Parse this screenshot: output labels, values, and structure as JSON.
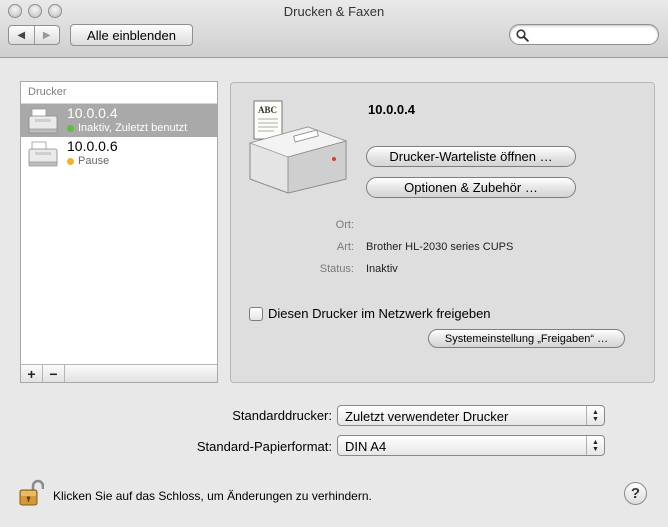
{
  "window": {
    "title": "Drucken & Faxen"
  },
  "toolbar": {
    "back_icon": "back-arrow-icon",
    "forward_icon": "forward-arrow-icon",
    "show_all_label": "Alle einblenden",
    "search_placeholder": "",
    "search_value": ""
  },
  "printer_list": {
    "header": "Drucker",
    "items": [
      {
        "name": "10.0.0.4",
        "status": "Inaktiv, Zuletzt benutzt",
        "status_color": "#5bbf3f",
        "selected": true
      },
      {
        "name": "10.0.0.6",
        "status": "Pause",
        "status_color": "#f0b429",
        "selected": false
      }
    ],
    "add_label": "+",
    "remove_label": "−"
  },
  "detail": {
    "printer_name": "10.0.0.4",
    "open_queue_label": "Drucker-Warteliste öffnen …",
    "options_label": "Optionen & Zubehör …",
    "location_label": "Ort:",
    "location_value": "",
    "kind_label": "Art:",
    "kind_value": "Brother HL-2030 series CUPS",
    "status_label": "Status:",
    "status_value": "Inaktiv",
    "share_checkbox_label": "Diesen Drucker im Netzwerk freigeben",
    "share_checked": false,
    "sharing_prefs_label": "Systemeinstellung „Freigaben“ …",
    "icon_badge": "ABC"
  },
  "defaults": {
    "default_printer_label": "Standarddrucker:",
    "default_printer_value": "Zuletzt verwendeter Drucker",
    "paper_size_label": "Standard-Papierformat:",
    "paper_size_value": "DIN A4"
  },
  "footer": {
    "lock_text": "Klicken Sie auf das Schloss, um Änderungen zu verhindern.",
    "help_label": "?"
  }
}
